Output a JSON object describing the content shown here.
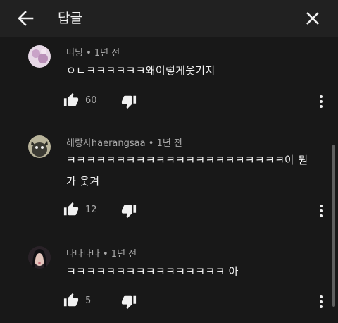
{
  "header": {
    "title": "답글",
    "back_icon": "arrow-left-icon",
    "close_icon": "close-icon"
  },
  "comments": [
    {
      "author": "띠닝",
      "time": "1년 전",
      "text": "ㅇㄴㅋㅋㅋㅋㅋㅋ왜이렇게웃기지",
      "likes": "60",
      "avatar_color": "#d9c7dd"
    },
    {
      "author": "해랑사haerangsaa",
      "time": "1년 전",
      "text": "ㅋㅋㅋㅋㅋㅋㅋㅋㅋㅋㅋㅋㅋㅋㅋㅋㅋㅋㅋㅋㅋㅋ아 뭔가 웃겨",
      "likes": "12",
      "avatar_color": "#6b6a5c"
    },
    {
      "author": "나나나나",
      "time": "1년 전",
      "text": "ㅋㅋㅋㅋㅋㅋㅋㅋㅋㅋㅋㅋㅋㅋㅋㅋ 아",
      "likes": "5",
      "avatar_color": "#3a2f35"
    }
  ],
  "icons": {
    "like": "thumbs-up-icon",
    "dislike": "thumbs-down-icon",
    "more": "more-vertical-icon"
  },
  "colors": {
    "background": "#181818",
    "header": "#212121",
    "text": "#f1f1f1",
    "secondary_text": "#aaaaaa"
  }
}
